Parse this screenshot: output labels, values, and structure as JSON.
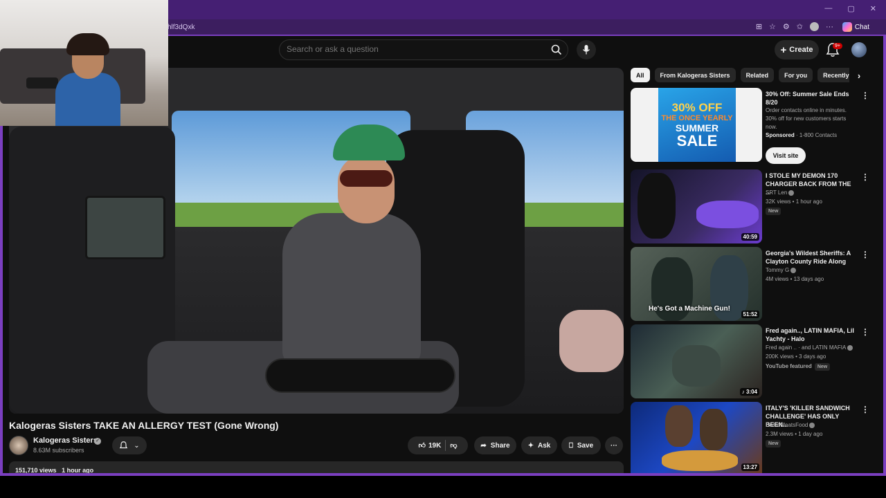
{
  "browser": {
    "url_fragment": "hlf3dQxk",
    "chat_label": "Chat",
    "window_controls": [
      "—",
      "▢",
      "✕"
    ]
  },
  "header": {
    "search_placeholder": "Search or ask a question",
    "create_label": "Create",
    "notification_count": "9+"
  },
  "video": {
    "title": "Kalogeras Sisters TAKE AN ALLERGY TEST (Gone Wrong)",
    "channel_name": "Kalogeras Sisters",
    "subscribers": "8.63M subscribers",
    "likes": "19K",
    "share_label": "Share",
    "ask_label": "Ask",
    "save_label": "Save",
    "views": "151,710 views",
    "posted": "1 hour ago"
  },
  "chips": [
    "All",
    "From Kalogeras Sisters",
    "Related",
    "For you",
    "Recently uploaded"
  ],
  "ad": {
    "thumb_line1": "30% OFF",
    "thumb_line2": "THE ONCE YEARLY",
    "thumb_line3": "SUMMER",
    "thumb_line4": "SALE",
    "title": "30% Off: Summer Sale Ends 8/20",
    "description": "Order contacts online in minutes. 30% off for new customers starts now.",
    "sponsored": "Sponsored",
    "advertiser": "· 1-800 Contacts",
    "cta": "Visit site"
  },
  "recommendations": [
    {
      "title": "I STOLE MY DEMON 170 CHARGER BACK FROM THE ...",
      "channel": "SRT Len",
      "stats": "32K views • 1 hour ago",
      "badge": "New",
      "duration": "40:59"
    },
    {
      "title": "Georgia's Wildest Sheriffs: A Clayton County Ride Along",
      "channel": "Tommy G",
      "stats": "4M views • 13 days ago",
      "duration": "51:52",
      "thumb_caption": "He's Got a Machine Gun!"
    },
    {
      "title": "Fred again.., LATIN MAFIA, Lil Yachty - Halo",
      "channel": "Fred again .. · and LATIN MAFIA",
      "stats": "200K views • 3 days ago",
      "featured": "YouTube featured",
      "badge": "New",
      "duration": "3:04"
    },
    {
      "title": "ITALY'S 'KILLER SANDWICH CHALLENGE' HAS ONLY BEEN...",
      "channel": "BeardMeatsFood",
      "stats": "2.3M views • 1 day ago",
      "badge": "New",
      "duration": "13:27"
    }
  ],
  "colors": {
    "browser_accent": "#7b3fc0",
    "titlebar": "#451f73",
    "page_bg": "#0f0f0f",
    "chip_bg": "#272727"
  }
}
